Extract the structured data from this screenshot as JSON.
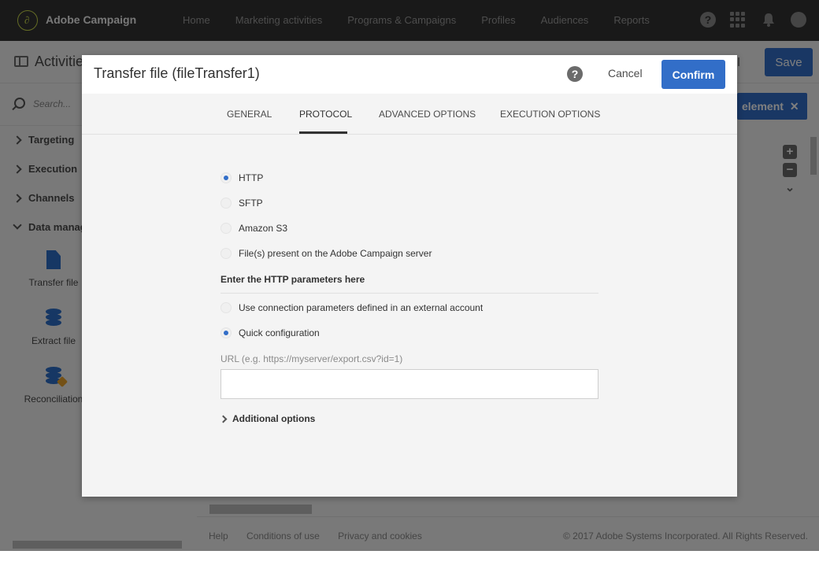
{
  "app": {
    "brand": "Adobe Campaign",
    "logo_glyph": "∂",
    "nav": [
      "Home",
      "Marketing activities",
      "Programs & Campaigns",
      "Profiles",
      "Audiences",
      "Reports"
    ],
    "icons": {
      "help": "?",
      "apps": "apps-grid-icon",
      "bell": "bell-icon",
      "avatar": "user-avatar-icon"
    }
  },
  "subheader": {
    "title": "Activities",
    "cancel_partial": "el",
    "save": "Save"
  },
  "sidebar": {
    "search_placeholder": "Search...",
    "categories": [
      {
        "label": "Targeting",
        "expanded": false
      },
      {
        "label": "Execution",
        "expanded": false
      },
      {
        "label": "Channels",
        "expanded": false
      },
      {
        "label": "Data management",
        "expanded": true
      }
    ],
    "tools": [
      {
        "label": "Transfer file",
        "icon": "file-upload-icon"
      },
      {
        "label": "Extract file",
        "icon": "database-export-icon"
      },
      {
        "label": "Reconciliation",
        "icon": "database-edit-icon"
      }
    ]
  },
  "canvas": {
    "add_element": "element",
    "add_element_close": "✕",
    "zoom_in": "+",
    "zoom_out": "−",
    "zoom_down": "⌄",
    "footer_links": [
      "Help",
      "Conditions of use",
      "Privacy and cookies"
    ],
    "copyright": "© 2017 Adobe Systems Incorporated. All Rights Reserved."
  },
  "dialog": {
    "title": "Transfer file (fileTransfer1)",
    "help": "?",
    "cancel": "Cancel",
    "confirm": "Confirm",
    "tabs": [
      {
        "label": "GENERAL",
        "active": false
      },
      {
        "label": "PROTOCOL",
        "active": true
      },
      {
        "label": "ADVANCED OPTIONS",
        "active": false
      },
      {
        "label": "EXECUTION OPTIONS",
        "active": false
      }
    ],
    "protocols": [
      {
        "label": "HTTP",
        "selected": true
      },
      {
        "label": "SFTP",
        "selected": false
      },
      {
        "label": "Amazon S3",
        "selected": false
      },
      {
        "label": "File(s) present on the Adobe Campaign server",
        "selected": false
      }
    ],
    "params_title": "Enter the HTTP parameters here",
    "connection_modes": [
      {
        "label": "Use connection parameters defined in an external account",
        "selected": false
      },
      {
        "label": "Quick configuration",
        "selected": true
      }
    ],
    "url_label": "URL (e.g. https://myserver/export.csv?id=1)",
    "url_value": "",
    "additional_options": "Additional options"
  },
  "colors": {
    "accent": "#326ec8",
    "topbar": "#323232",
    "logo": "#c9d84a",
    "warning_icon": "#e8a32d"
  }
}
